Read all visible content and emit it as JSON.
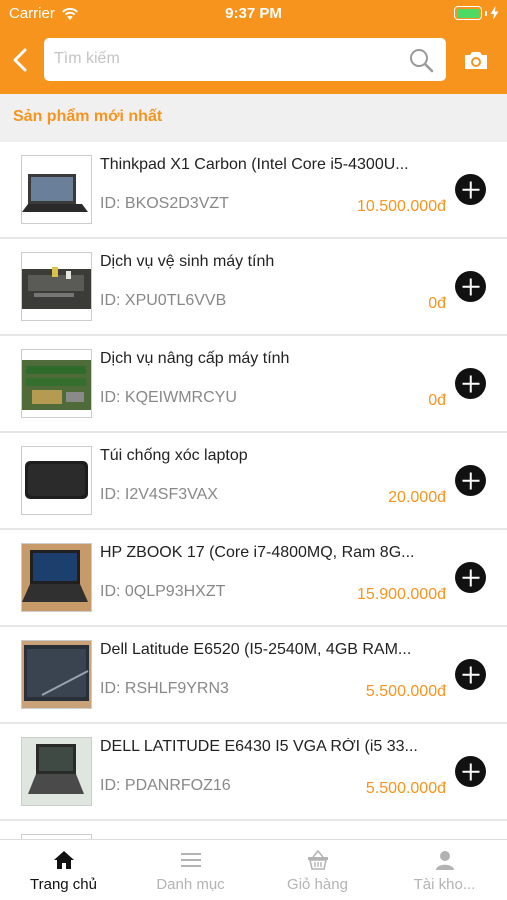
{
  "status": {
    "carrier": "Carrier",
    "time": "9:37 PM"
  },
  "search": {
    "placeholder": "Tìm kiếm"
  },
  "section_title": "Sản phẩm mới nhất",
  "products": [
    {
      "name": "Thinkpad X1 Carbon (Intel Core i5-4300U...",
      "id": "ID: BKOS2D3VZT",
      "price": "10.500.000đ"
    },
    {
      "name": "Dịch vụ vệ sinh máy tính",
      "id": "ID: XPU0TL6VVB",
      "price": "0đ"
    },
    {
      "name": "Dịch vụ nâng cấp máy tính",
      "id": "ID: KQEIWMRCYU",
      "price": "0đ"
    },
    {
      "name": "Túi chống xóc laptop",
      "id": "ID: I2V4SF3VAX",
      "price": "20.000đ"
    },
    {
      "name": "HP ZBOOK 17 (Core i7-4800MQ, Ram 8G...",
      "id": "ID: 0QLP93HXZT",
      "price": "15.900.000đ"
    },
    {
      "name": "Dell Latitude E6520 (I5-2540M, 4GB RAM...",
      "id": "ID: RSHLF9YRN3",
      "price": "5.500.000đ"
    },
    {
      "name": "DELL LATITUDE E6430 I5 VGA RỜI (i5 33...",
      "id": "ID: PDANRFOZ16",
      "price": "5.500.000đ"
    }
  ],
  "tabs": [
    {
      "label": "Trang chủ",
      "icon": "home-icon"
    },
    {
      "label": "Danh mục",
      "icon": "menu-icon"
    },
    {
      "label": "Giỏ hàng",
      "icon": "basket-icon"
    },
    {
      "label": "Tài kho...",
      "icon": "user-icon"
    }
  ],
  "colors": {
    "accent": "#f7941d",
    "battery": "#4cd964"
  }
}
